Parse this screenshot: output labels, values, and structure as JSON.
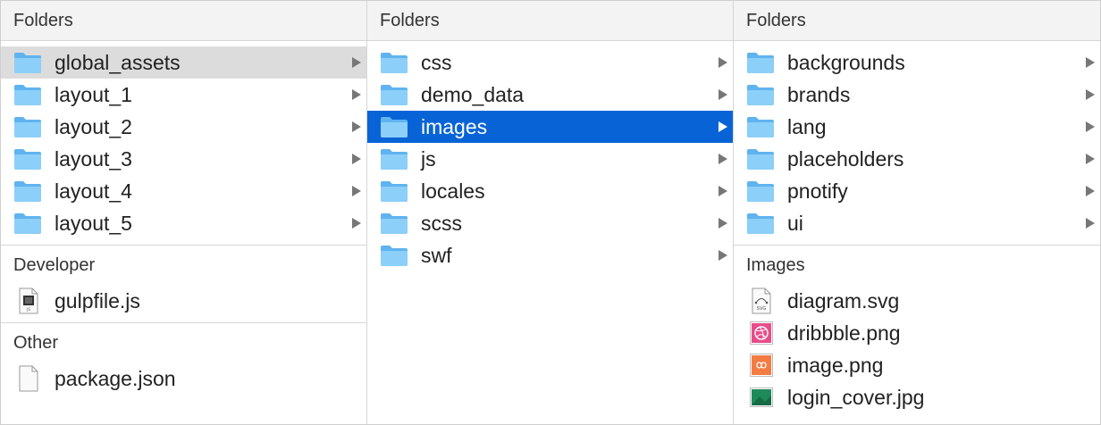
{
  "columns": [
    {
      "header": "Folders",
      "folders": [
        {
          "name": "global_assets",
          "state": "hover"
        },
        {
          "name": "layout_1"
        },
        {
          "name": "layout_2"
        },
        {
          "name": "layout_3"
        },
        {
          "name": "layout_4"
        },
        {
          "name": "layout_5"
        }
      ],
      "sections": [
        {
          "title": "Developer",
          "files": [
            {
              "name": "gulpfile.js",
              "icon": "js-file-icon"
            }
          ]
        },
        {
          "title": "Other",
          "files": [
            {
              "name": "package.json",
              "icon": "generic-file-icon"
            }
          ]
        }
      ]
    },
    {
      "header": "Folders",
      "folders": [
        {
          "name": "css"
        },
        {
          "name": "demo_data"
        },
        {
          "name": "images",
          "state": "selected"
        },
        {
          "name": "js"
        },
        {
          "name": "locales"
        },
        {
          "name": "scss"
        },
        {
          "name": "swf"
        }
      ]
    },
    {
      "header": "Folders",
      "folders": [
        {
          "name": "backgrounds"
        },
        {
          "name": "brands"
        },
        {
          "name": "lang"
        },
        {
          "name": "placeholders"
        },
        {
          "name": "pnotify"
        },
        {
          "name": "ui"
        }
      ],
      "sections": [
        {
          "title": "Images",
          "files": [
            {
              "name": "diagram.svg",
              "icon": "svg-file-icon",
              "icon_label": "SVG"
            },
            {
              "name": "dribbble.png",
              "icon": "dribbble-image-icon"
            },
            {
              "name": "image.png",
              "icon": "orange-image-icon"
            },
            {
              "name": "login_cover.jpg",
              "icon": "green-image-icon"
            }
          ]
        }
      ]
    }
  ],
  "colors": {
    "selection": "#0864d6",
    "hover": "#dcdcdc",
    "folder": "#7cc4f4",
    "dribbble": "#e84c8b",
    "orange": "#f47b42",
    "green": "#1e8a5a"
  }
}
